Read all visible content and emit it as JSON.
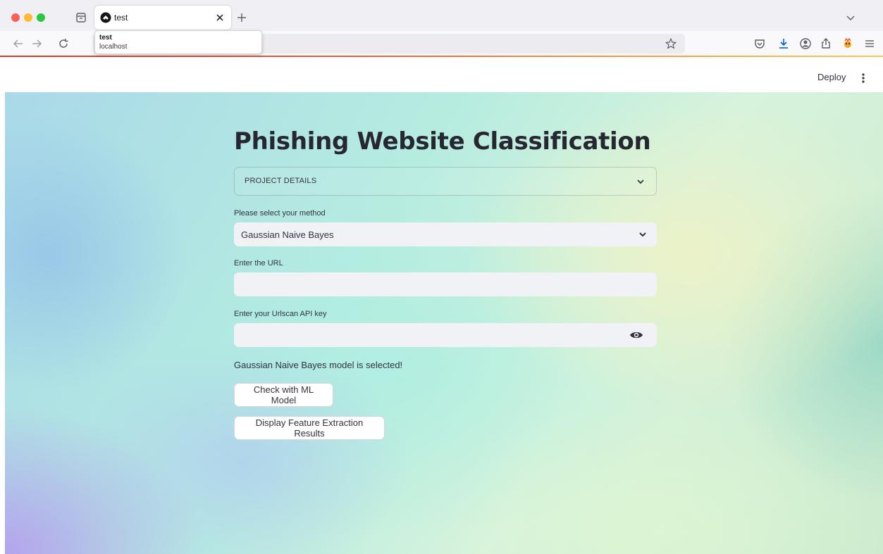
{
  "browser": {
    "tab_title": "test",
    "tooltip": {
      "title": "test",
      "url": "localhost"
    },
    "icons": {
      "tab_overview": "tab-overview-icon",
      "favicon": "streamlit-favicon-icon",
      "close": "close-icon",
      "new_tab": "plus-icon",
      "tab_list": "chevron-down-icon",
      "back": "arrow-left-icon",
      "forward": "arrow-right-icon",
      "reload": "reload-icon",
      "bookmark": "star-icon",
      "pocket": "pocket-icon",
      "downloads": "download-icon",
      "account": "account-icon",
      "share": "share-icon",
      "extension": "extension-icon",
      "menu": "hamburger-menu-icon"
    }
  },
  "app_header": {
    "deploy_label": "Deploy",
    "menu_icon": "kebab-menu-icon"
  },
  "main": {
    "title": "Phishing Website Classification",
    "expander": {
      "label": "PROJECT DETAILS",
      "icon": "chevron-down-icon"
    },
    "method_select": {
      "label": "Please select your method",
      "value": "Gaussian Naive Bayes",
      "icon": "chevron-down-icon"
    },
    "url_input": {
      "label": "Enter the URL",
      "value": ""
    },
    "api_key_input": {
      "label": "Enter your Urlscan API key",
      "value": "",
      "icon": "eye-icon"
    },
    "selected_message": "Gaussian Naive Bayes model is selected!",
    "check_button": "Check with ML Model",
    "display_button": "Display Feature Extraction Results"
  },
  "colors": {
    "text": "#31333f",
    "title": "#262730",
    "input_bg": "#f0f2f6",
    "load_bar_start": "#d13c2f",
    "load_bar_end": "#f6c85b"
  }
}
